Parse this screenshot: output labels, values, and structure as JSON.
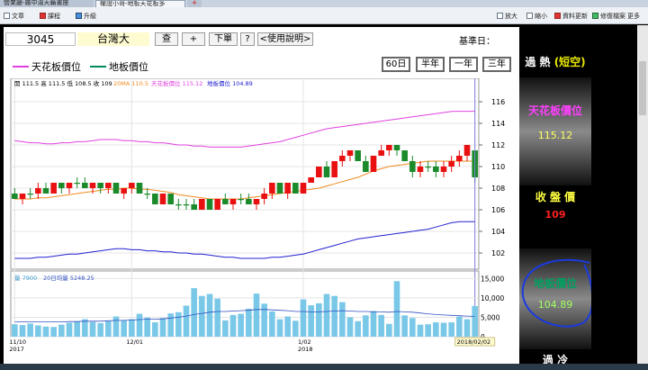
{
  "browser": {
    "tabs": [
      {
        "label": "營業廳-霧中湯天籟書座",
        "active": false
      },
      {
        "label": "權證小哥-地板天花板多",
        "active": true
      }
    ],
    "new_tab": "+"
  },
  "toolbar": {
    "items": [
      "文章",
      "課程",
      "升級"
    ],
    "right_items": [
      "放大",
      "縮小",
      "資料更新",
      "修復檔案",
      "更多"
    ]
  },
  "stock": {
    "code": "3045",
    "name": "台灣大",
    "buttons": [
      "查",
      "+",
      "下單",
      "?",
      "<使用說明>"
    ],
    "date_label": "基準日：",
    "date_value": "20180202"
  },
  "legend": {
    "ceiling": "天花板價位",
    "floor": "地板價位",
    "ceiling_color": "#e040e0",
    "floor_color": "#008a5a"
  },
  "periods": [
    "60日",
    "半年",
    "一年",
    "三年"
  ],
  "side": {
    "status": "過 熱",
    "status_paren": "(短空)",
    "ceiling_title": "天花板價位",
    "ceiling_value": "115.12",
    "close_title": "收 盤 價",
    "close_value": "109",
    "floor_title": "地板價位",
    "floor_value": "104.89",
    "bottom_title": "過 冷"
  },
  "chart_data": {
    "type": "candlestick",
    "ohlc_label": "開 111.5  高 111.5  低 108.5  收 109",
    "ma_label": "20MA 110.5",
    "ceil_label": "天花板價位 115.12",
    "floor_label": "地板價位 104.89",
    "vol_label": "量 7900",
    "vol_ma_label": "20日均量 5248.25",
    "y_ticks": [
      102,
      104,
      106,
      108,
      110,
      112,
      114,
      116
    ],
    "ylim": [
      100.5,
      117
    ],
    "vol_ticks": [
      "0",
      "5,000",
      "10,000",
      "15,000"
    ],
    "vol_lim": [
      0,
      16000
    ],
    "x_labels": [
      {
        "label": "11/10",
        "sub": "2017",
        "index": 0
      },
      {
        "label": "12/01",
        "sub": "",
        "index": 15
      },
      {
        "label": "1/02",
        "sub": "2018",
        "index": 37
      },
      {
        "label": "2018/02/02",
        "sub": "",
        "index": 59
      }
    ],
    "ceiling": [
      112.4,
      112.3,
      112.2,
      112.2,
      112.1,
      112.1,
      112.2,
      112.2,
      112.3,
      112.3,
      112.4,
      112.5,
      112.5,
      112.5,
      112.4,
      112.4,
      112.3,
      112.3,
      112.2,
      112.2,
      112.1,
      112.0,
      112.0,
      111.9,
      111.9,
      111.8,
      111.8,
      111.8,
      111.8,
      111.8,
      111.9,
      112.0,
      112.1,
      112.2,
      112.3,
      112.5,
      112.7,
      112.9,
      113.1,
      113.3,
      113.5,
      113.6,
      113.7,
      113.8,
      113.9,
      114.0,
      114.1,
      114.2,
      114.3,
      114.4,
      114.5,
      114.6,
      114.7,
      114.8,
      114.9,
      115.0,
      115.1,
      115.12,
      115.12,
      115.12
    ],
    "floor": [
      101.5,
      101.5,
      101.5,
      101.6,
      101.6,
      101.7,
      101.8,
      101.9,
      101.9,
      102.0,
      102.1,
      102.2,
      102.3,
      102.4,
      102.4,
      102.3,
      102.3,
      102.2,
      102.2,
      102.1,
      102.1,
      102.0,
      102.0,
      101.9,
      101.9,
      101.8,
      101.7,
      101.6,
      101.6,
      101.5,
      101.5,
      101.5,
      101.5,
      101.6,
      101.6,
      101.7,
      101.8,
      101.9,
      102.1,
      102.3,
      102.5,
      102.7,
      102.9,
      103.1,
      103.3,
      103.4,
      103.5,
      103.6,
      103.7,
      103.8,
      103.9,
      104.0,
      104.1,
      104.2,
      104.4,
      104.6,
      104.8,
      104.89,
      104.89,
      104.89
    ],
    "ma20": [
      107.0,
      107.0,
      107.0,
      107.1,
      107.1,
      107.2,
      107.3,
      107.4,
      107.5,
      107.6,
      107.7,
      107.8,
      107.9,
      107.9,
      108.0,
      108.0,
      107.9,
      107.9,
      107.8,
      107.7,
      107.6,
      107.4,
      107.3,
      107.2,
      107.1,
      107.0,
      107.0,
      107.0,
      107.0,
      107.0,
      107.1,
      107.2,
      107.3,
      107.4,
      107.5,
      107.6,
      107.7,
      107.8,
      107.9,
      108.0,
      108.2,
      108.4,
      108.6,
      108.8,
      109.0,
      109.3,
      109.6,
      109.8,
      110.0,
      110.1,
      110.2,
      110.3,
      110.4,
      110.5,
      110.5,
      110.5,
      110.5,
      110.5,
      110.5,
      110.5
    ],
    "candles": [
      [
        107.5,
        108.0,
        107.0,
        107.0
      ],
      [
        107.0,
        107.5,
        106.5,
        107.5
      ],
      [
        107.5,
        108.0,
        107.0,
        107.5
      ],
      [
        107.5,
        108.5,
        107.0,
        108.0
      ],
      [
        108.0,
        108.5,
        107.5,
        107.5
      ],
      [
        107.5,
        108.5,
        107.5,
        108.5
      ],
      [
        108.5,
        108.5,
        107.5,
        108.0
      ],
      [
        108.0,
        108.5,
        107.5,
        108.5
      ],
      [
        108.5,
        109.0,
        108.0,
        108.5
      ],
      [
        108.5,
        109.0,
        108.0,
        108.0
      ],
      [
        108.0,
        108.5,
        107.5,
        108.5
      ],
      [
        108.5,
        108.5,
        107.5,
        108.0
      ],
      [
        108.0,
        108.5,
        107.5,
        108.5
      ],
      [
        108.5,
        108.5,
        107.5,
        107.5
      ],
      [
        107.5,
        108.0,
        107.0,
        108.0
      ],
      [
        108.0,
        108.5,
        107.5,
        108.5
      ],
      [
        108.5,
        108.5,
        107.5,
        107.5
      ],
      [
        107.5,
        108.0,
        107.0,
        107.5
      ],
      [
        107.5,
        107.5,
        106.5,
        106.5
      ],
      [
        106.5,
        107.5,
        106.5,
        107.5
      ],
      [
        107.5,
        107.5,
        106.5,
        106.5
      ],
      [
        106.5,
        107.0,
        106.0,
        106.5
      ],
      [
        106.5,
        107.0,
        106.0,
        106.5
      ],
      [
        106.5,
        107.0,
        106.0,
        106.0
      ],
      [
        106.0,
        107.0,
        106.0,
        107.0
      ],
      [
        107.0,
        107.0,
        106.0,
        106.0
      ],
      [
        106.0,
        107.0,
        106.0,
        107.0
      ],
      [
        107.0,
        107.5,
        106.5,
        106.5
      ],
      [
        106.5,
        107.0,
        106.0,
        107.0
      ],
      [
        107.0,
        107.5,
        106.5,
        107.0
      ],
      [
        107.0,
        107.5,
        106.5,
        106.5
      ],
      [
        106.5,
        107.0,
        106.0,
        107.0
      ],
      [
        107.0,
        108.0,
        106.5,
        107.5
      ],
      [
        107.5,
        108.5,
        107.0,
        108.5
      ],
      [
        108.5,
        108.5,
        107.5,
        107.5
      ],
      [
        107.5,
        108.5,
        107.0,
        108.5
      ],
      [
        108.5,
        108.5,
        107.5,
        107.5
      ],
      [
        107.5,
        108.5,
        107.5,
        108.5
      ],
      [
        108.5,
        109.0,
        108.5,
        109.0
      ],
      [
        109.0,
        110.0,
        109.0,
        110.0
      ],
      [
        110.0,
        110.5,
        109.0,
        109.0
      ],
      [
        109.0,
        110.5,
        109.0,
        110.5
      ],
      [
        110.5,
        111.5,
        110.0,
        111.0
      ],
      [
        111.0,
        111.5,
        110.5,
        111.5
      ],
      [
        111.5,
        111.5,
        110.5,
        110.5
      ],
      [
        110.5,
        111.0,
        109.5,
        109.5
      ],
      [
        109.5,
        111.0,
        109.5,
        111.0
      ],
      [
        111.0,
        112.0,
        111.0,
        111.5
      ],
      [
        111.5,
        112.0,
        111.0,
        112.0
      ],
      [
        112.0,
        112.0,
        111.0,
        111.5
      ],
      [
        111.5,
        111.5,
        110.5,
        110.5
      ],
      [
        110.5,
        111.0,
        109.0,
        109.5
      ],
      [
        109.5,
        110.5,
        109.0,
        110.0
      ],
      [
        110.0,
        110.5,
        109.5,
        110.0
      ],
      [
        110.0,
        110.5,
        109.0,
        109.5
      ],
      [
        109.5,
        110.5,
        109.0,
        110.0
      ],
      [
        110.0,
        111.0,
        109.5,
        110.5
      ],
      [
        110.5,
        111.5,
        110.0,
        111.0
      ],
      [
        111.0,
        112.0,
        110.5,
        112.0
      ],
      [
        111.5,
        111.5,
        108.5,
        109.0
      ]
    ],
    "volume": [
      3200,
      3000,
      3400,
      2900,
      2600,
      2500,
      3100,
      3600,
      3900,
      4500,
      3800,
      3500,
      4000,
      5200,
      4200,
      4500,
      5900,
      4900,
      3700,
      4800,
      6000,
      6300,
      8000,
      12500,
      10500,
      11000,
      9800,
      4200,
      5600,
      5900,
      7200,
      11100,
      8500,
      6500,
      4500,
      5200,
      4100,
      9600,
      8100,
      8600,
      11000,
      10500,
      8900,
      5000,
      4000,
      5500,
      6600,
      5600,
      3300,
      14300,
      5500,
      4800,
      3100,
      3200,
      3700,
      3600,
      3700,
      5200,
      4500,
      7900
    ],
    "vol_ma": [
      3800,
      3800,
      3800,
      3800,
      3800,
      3800,
      3800,
      3900,
      3900,
      4000,
      4000,
      4000,
      4100,
      4200,
      4200,
      4300,
      4400,
      4500,
      4500,
      4600,
      4800,
      5000,
      5300,
      5700,
      6000,
      6300,
      6500,
      6500,
      6600,
      6700,
      6800,
      7000,
      7000,
      6900,
      6800,
      6700,
      6500,
      6500,
      6400,
      6400,
      6500,
      6600,
      6700,
      6600,
      6500,
      6500,
      6400,
      6400,
      6300,
      6500,
      6400,
      6300,
      6100,
      5900,
      5700,
      5600,
      5500,
      5400,
      5300,
      5248
    ]
  }
}
